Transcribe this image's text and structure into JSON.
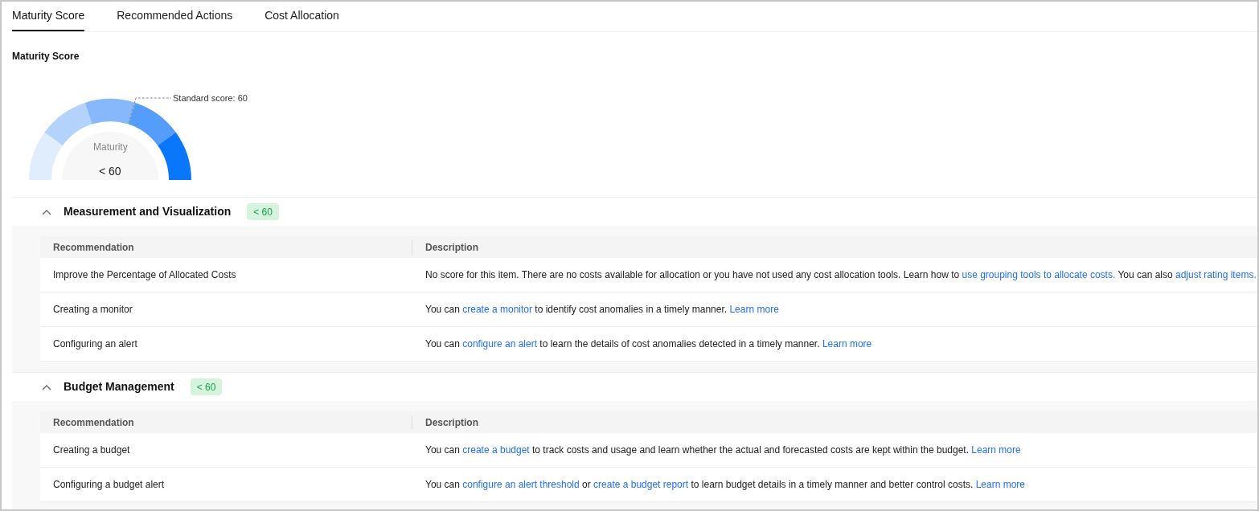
{
  "tabs": [
    {
      "label": "Maturity Score",
      "selected": true
    },
    {
      "label": "Recommended Actions",
      "selected": false
    },
    {
      "label": "Cost Allocation",
      "selected": false
    }
  ],
  "score_panel": {
    "title": "Maturity Score",
    "gauge": {
      "standard_label": "Standard score: 60",
      "center_label": "Maturity",
      "center_value": "< 60"
    }
  },
  "sections": [
    {
      "title": "Measurement and Visualization",
      "badge": "< 60",
      "expanded": true,
      "columns": [
        "Recommendation",
        "Description"
      ],
      "rows": [
        {
          "recommendation": "Improve the Percentage of Allocated Costs",
          "description": [
            {
              "kind": "text",
              "text": "No score for this item. There are no costs available for allocation or you have not used any cost allocation tools. Learn how to "
            },
            {
              "kind": "link",
              "text": "use grouping tools to allocate costs."
            },
            {
              "kind": "text",
              "text": " You can also "
            },
            {
              "kind": "link",
              "text": "adjust rating items."
            }
          ]
        },
        {
          "recommendation": "Creating a monitor",
          "description": [
            {
              "kind": "text",
              "text": "You can "
            },
            {
              "kind": "link",
              "text": "create a monitor"
            },
            {
              "kind": "text",
              "text": " to identify cost anomalies in a timely manner. "
            },
            {
              "kind": "link",
              "text": "Learn more"
            }
          ]
        },
        {
          "recommendation": "Configuring an alert",
          "description": [
            {
              "kind": "text",
              "text": "You can "
            },
            {
              "kind": "link",
              "text": "configure an alert"
            },
            {
              "kind": "text",
              "text": " to learn the details of cost anomalies detected in a timely manner. "
            },
            {
              "kind": "link",
              "text": "Learn more"
            }
          ]
        }
      ]
    },
    {
      "title": "Budget Management",
      "badge": "< 60",
      "expanded": true,
      "columns": [
        "Recommendation",
        "Description"
      ],
      "rows": [
        {
          "recommendation": "Creating a budget",
          "description": [
            {
              "kind": "text",
              "text": "You can "
            },
            {
              "kind": "link",
              "text": "create a budget"
            },
            {
              "kind": "text",
              "text": " to track costs and usage and learn whether the actual and forecasted costs are kept within the budget. "
            },
            {
              "kind": "link",
              "text": "Learn more"
            }
          ]
        },
        {
          "recommendation": "Configuring a budget alert",
          "description": [
            {
              "kind": "text",
              "text": "You can "
            },
            {
              "kind": "link",
              "text": "configure an alert threshold"
            },
            {
              "kind": "text",
              "text": " or "
            },
            {
              "kind": "link",
              "text": "create a budget report"
            },
            {
              "kind": "text",
              "text": " to learn budget details in a timely manner and better control costs. "
            },
            {
              "kind": "link",
              "text": "Learn more"
            }
          ]
        }
      ]
    }
  ]
}
